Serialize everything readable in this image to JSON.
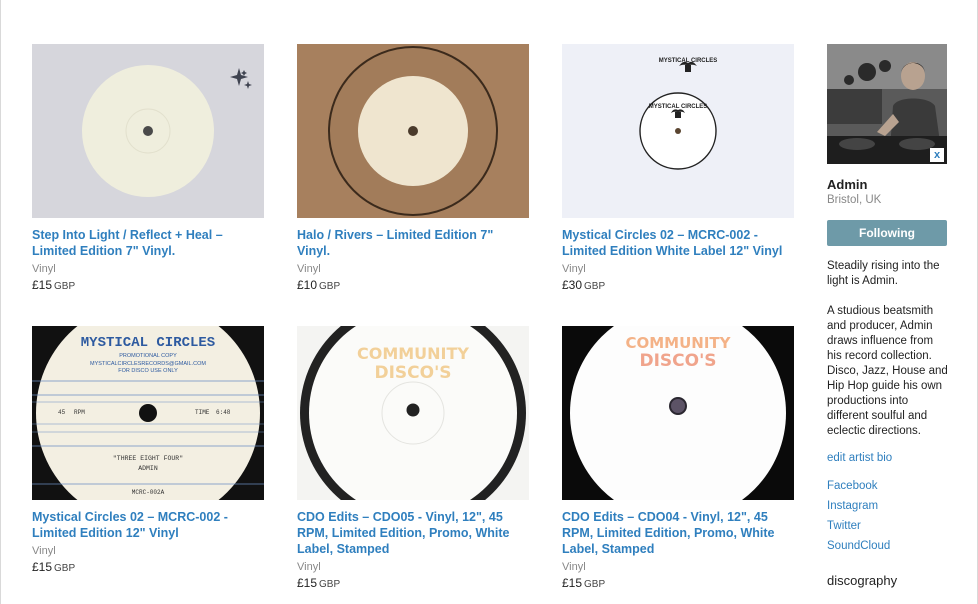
{
  "releases": [
    {
      "title": "Step Into Light / Reflect + Heal – Limited Edition 7\" Vinyl.",
      "format": "Vinyl",
      "price": "£15",
      "currency": "GBP"
    },
    {
      "title": "Halo / Rivers – Limited Edition 7\" Vinyl.",
      "format": "Vinyl",
      "price": "£10",
      "currency": "GBP"
    },
    {
      "title": "Mystical Circles 02 – MCRC-002 - Limited Edition White Label 12\" Vinyl",
      "format": "Vinyl",
      "price": "£30",
      "currency": "GBP"
    },
    {
      "title": "Mystical Circles 02 – MCRC-002 - Limited Edition 12\" Vinyl",
      "format": "Vinyl",
      "price": "£15",
      "currency": "GBP"
    },
    {
      "title": "CDO Edits – CDO05 - Vinyl, 12\", 45 RPM, Limited Edition, Promo, White Label, Stamped",
      "format": "Vinyl",
      "price": "£15",
      "currency": "GBP"
    },
    {
      "title": "CDO Edits – CDO04 - Vinyl, 12\", 45 RPM, Limited Edition, Promo, White Label, Stamped",
      "format": "Vinyl",
      "price": "£15",
      "currency": "GBP"
    }
  ],
  "artwork_text": {
    "mc_label_title": "MYSTICAL CIRCLES",
    "mc_label_line1": "PROMOTIONAL COPY",
    "mc_label_line2": "MYSTICALCIRCLESRECORDS@GMAIL.COM",
    "mc_label_line3": "FOR DISCO USE ONLY",
    "mc_label_rpm": "45",
    "mc_label_rpm_unit": "RPM",
    "mc_label_time": "TIME",
    "mc_label_time_value": "6:48",
    "mc_label_track": "\"THREE EIGHT FOUR\"",
    "mc_label_artist": "ADMIN",
    "mc_label_cat": "MCRC-002A",
    "mc_white_top": "MYSTICAL CIRCLES",
    "cdo_stamp_line1": "COMMUNITY",
    "cdo_stamp_line2": "DISCO'S"
  },
  "sidebar": {
    "avatar_badge": "x",
    "artist_name": "Admin",
    "location": "Bristol, UK",
    "follow_label": "Following",
    "bio_short": "Steadily rising into the light is Admin.",
    "bio_long": "A studious beatsmith and producer, Admin draws influence from his record collection. Disco, Jazz, House and Hip Hop guide his own productions into different soulful and eclectic directions.",
    "edit_bio_label": "edit artist bio",
    "links": [
      "Facebook",
      "Instagram",
      "Twitter",
      "SoundCloud"
    ],
    "discography_label": "discography"
  },
  "colors": {
    "link": "#2f7fbe",
    "follow_button": "#6e9aa8"
  }
}
